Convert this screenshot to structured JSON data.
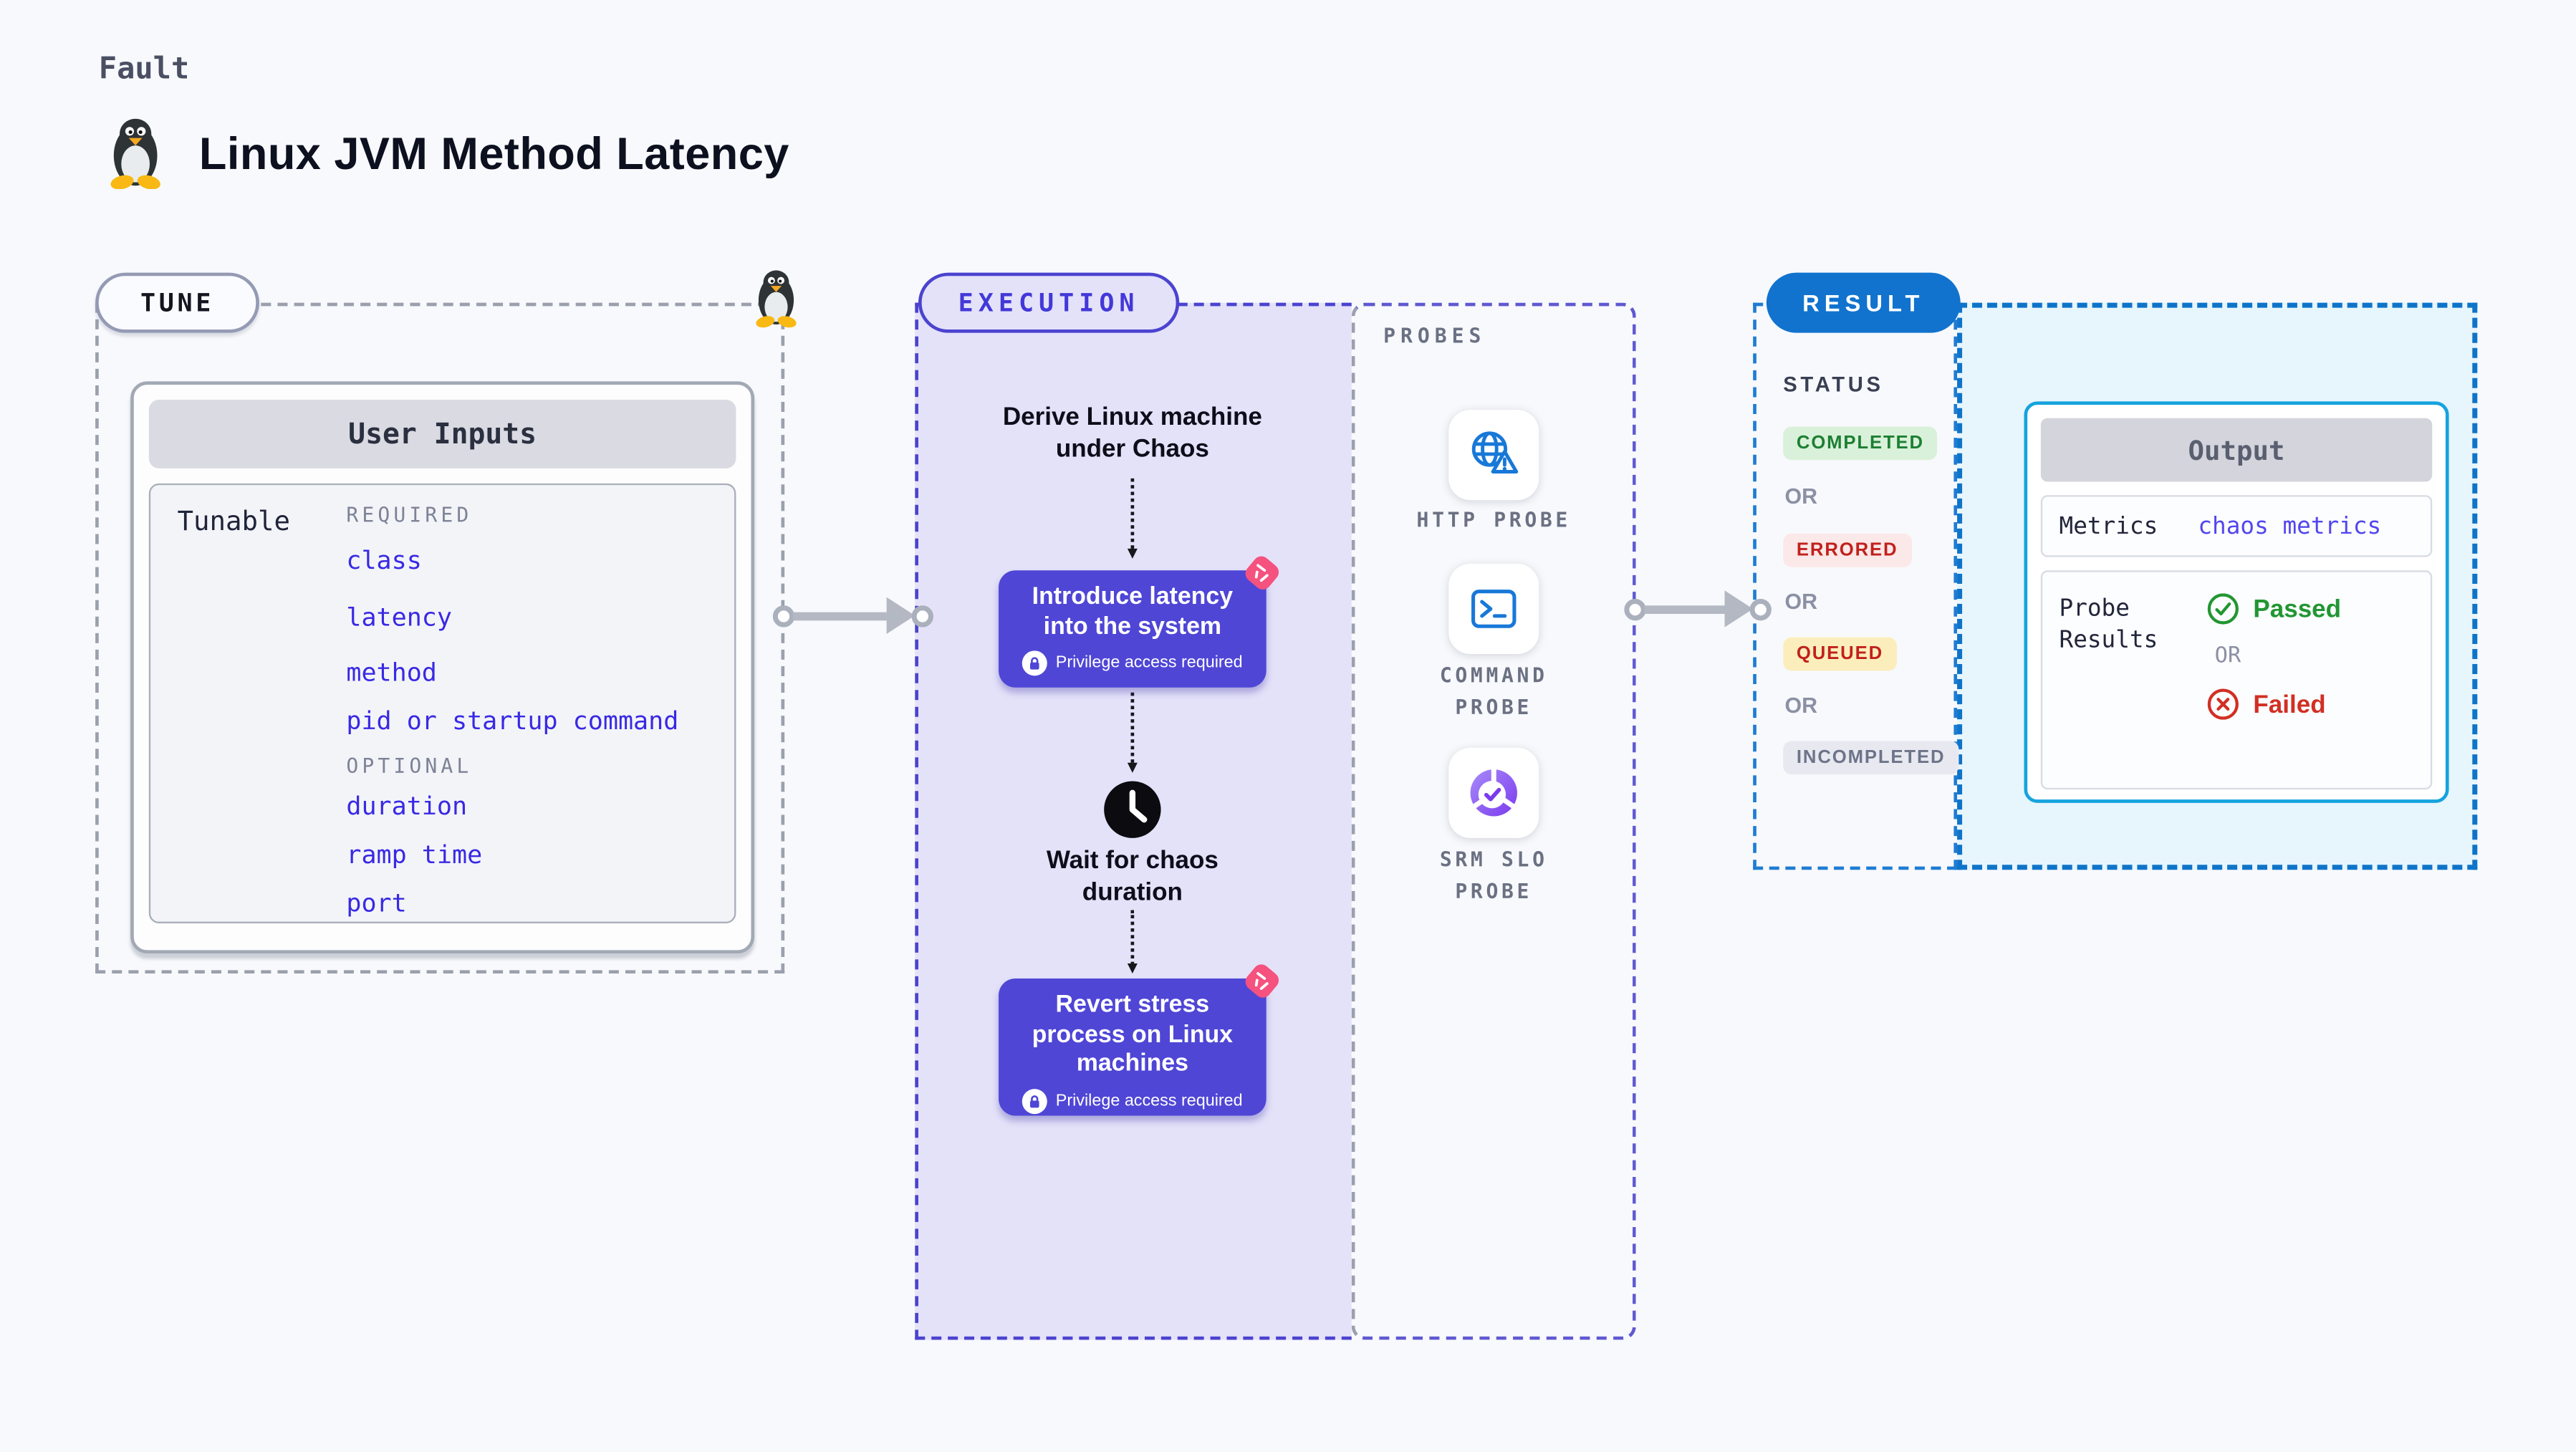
{
  "page": {
    "kicker": "Fault",
    "title": "Linux JVM Method Latency",
    "title_icon": "linux-penguin-icon"
  },
  "colors": {
    "page_bg": "#f8f9fc",
    "indigo_accent": "#4f46d6",
    "indigo_dash": "#4b43cf",
    "lavender_fill": "#e4e2f9",
    "gray_dash": "#9aa0ac",
    "arrow_gray": "#b4b8c2",
    "result_blue": "#1173ce",
    "output_border_cyan": "#15a3de",
    "output_bg": "#e7f5fc",
    "link_blue": "#3929e4",
    "metrics_link": "#5246ee",
    "pink_chaos": "#f5527f",
    "green_pass": "#229632",
    "red_fail": "#d22f23",
    "badge_completed_bg": "#d9f1da",
    "badge_completed_fg": "#1d7f33",
    "badge_errored_bg": "#fbe8e8",
    "badge_errored_fg": "#c0211c",
    "badge_queued_bg": "#fceebc",
    "badge_queued_fg": "#c0211c",
    "badge_incompleted_bg": "#e8e9f0",
    "badge_incompleted_fg": "#6d7389"
  },
  "tune": {
    "pill": "TUNE",
    "corner_icon": "linux-penguin-icon",
    "card_title": "User Inputs",
    "row_label": "Tunable",
    "required_label": "REQUIRED",
    "optional_label": "OPTIONAL",
    "required": [
      "class",
      "latency",
      "method",
      "pid or startup command"
    ],
    "optional": [
      "duration",
      "ramp time",
      "port"
    ]
  },
  "execution": {
    "pill": "EXECUTION",
    "derive_lines": [
      "Derive Linux machine",
      "under Chaos"
    ],
    "introduce_lines": [
      "Introduce latency",
      "into the system"
    ],
    "wait_lines": [
      "Wait for chaos",
      "duration"
    ],
    "revert_lines": [
      "Revert stress",
      "process on Linux",
      "machines"
    ],
    "privilege_note": "Privilege access required",
    "privilege_icon": "lock-icon",
    "step_corner_icon": "chaos-pinwheel-icon",
    "wait_icon": "clock-icon"
  },
  "probes": {
    "section_label": "PROBES",
    "items": [
      {
        "icon": "globe-warning-icon",
        "lines": [
          "HTTP PROBE",
          ""
        ]
      },
      {
        "icon": "terminal-icon",
        "lines": [
          "COMMAND",
          "PROBE"
        ]
      },
      {
        "icon": "slo-donut-check-icon",
        "lines": [
          "SRM SLO",
          "PROBE"
        ]
      }
    ]
  },
  "result": {
    "pill": "RESULT",
    "status_label": "STATUS",
    "or_label": "OR",
    "statuses": [
      "COMPLETED",
      "ERRORED",
      "QUEUED",
      "INCOMPLETED"
    ],
    "output": {
      "title": "Output",
      "metrics_label": "Metrics",
      "metrics_value": "chaos metrics",
      "probe_results_lines": [
        "Probe",
        "Results"
      ],
      "passed": "Passed",
      "failed": "Failed",
      "or_label": "OR",
      "passed_icon": "check-circle-icon",
      "failed_icon": "x-circle-icon"
    }
  }
}
